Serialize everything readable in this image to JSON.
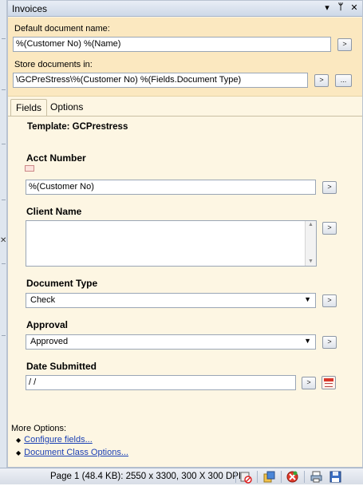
{
  "panel": {
    "title": "Invoices",
    "title_icons": [
      "dropdown-arrow-icon",
      "pin-icon",
      "close-icon"
    ]
  },
  "header": {
    "default_name_label": "Default document name:",
    "default_name_value": "%(Customer No) %(Name)",
    "store_label": "Store documents in:",
    "store_value": "\\GCPreStress\\%(Customer No) %(Fields.Document Type)",
    "arrow_button": ">",
    "browse_button": "..."
  },
  "tabs": [
    {
      "label": "Fields",
      "active": true
    },
    {
      "label": "Options",
      "active": false
    }
  ],
  "template": "Template: GCPrestress",
  "fields": {
    "acct_number": {
      "label": "Acct Number",
      "value": "%(Customer No)"
    },
    "client_name": {
      "label": "Client Name",
      "value": ""
    },
    "document_type": {
      "label": "Document Type",
      "value": "Check"
    },
    "approval": {
      "label": "Approval",
      "value": "Approved"
    },
    "date_submitted": {
      "label": "Date Submitted",
      "value": " / /"
    }
  },
  "more_options": {
    "label": "More Options:",
    "links": [
      "Configure fields...",
      "Document Class Options..."
    ]
  },
  "status": {
    "text": "Page 1 (48.4 KB): 2550 x 3300, 300 X 300 DPI",
    "icons": [
      "no-scan-icon",
      "export-icon",
      "stop-icon",
      "print-icon",
      "save-icon"
    ]
  },
  "colors": {
    "header_bg": "#fbe8c0",
    "panel_bg": "#fdf6e3",
    "link": "#1a3fb4"
  }
}
